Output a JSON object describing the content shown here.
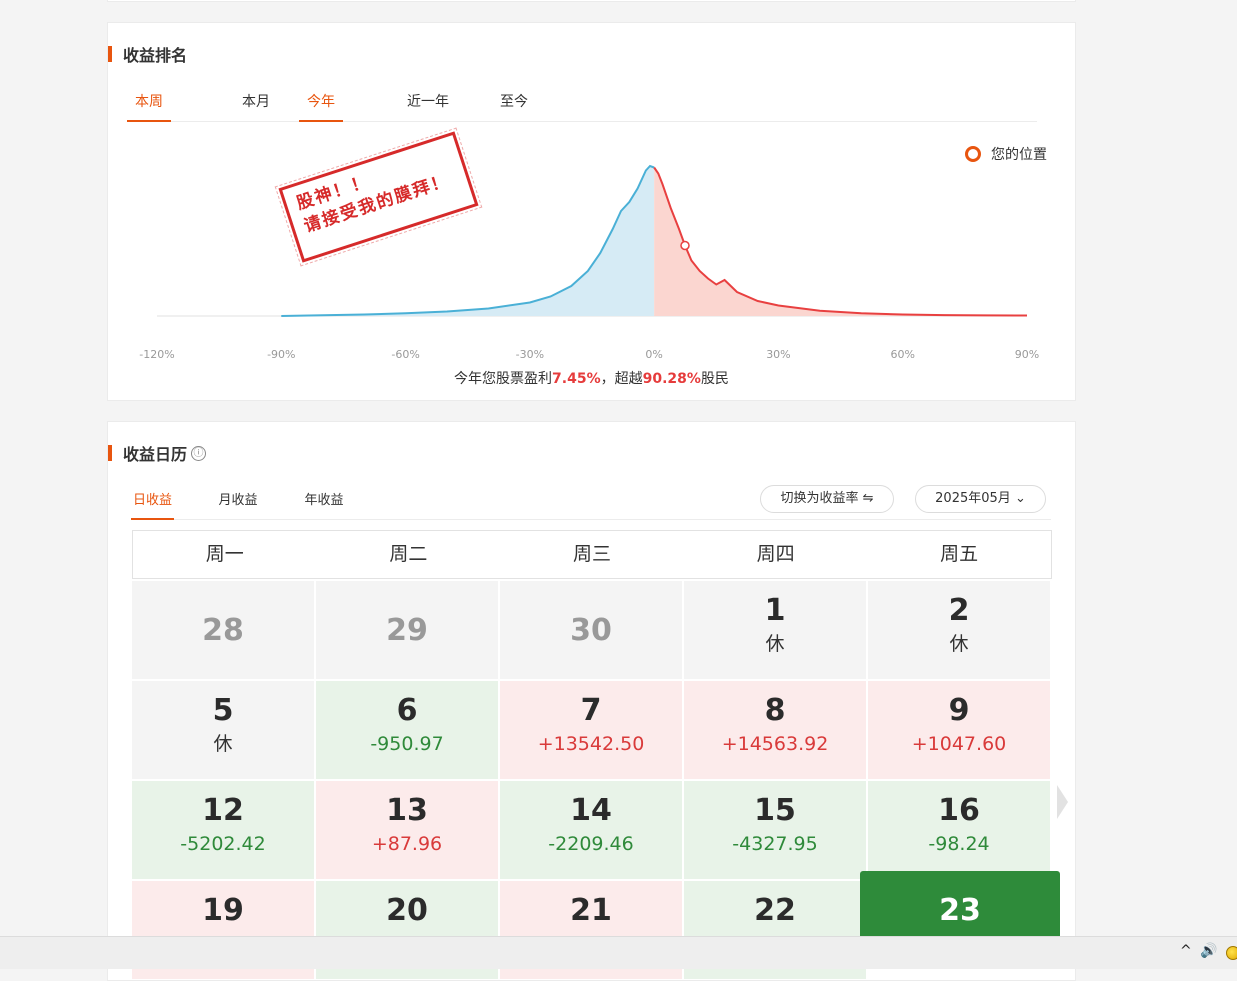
{
  "ranking": {
    "title": "收益排名",
    "tabs": [
      {
        "label": "本周",
        "active": true
      },
      {
        "label": "本月",
        "active": false
      },
      {
        "label": "今年",
        "active": true
      },
      {
        "label": "近一年",
        "active": false
      },
      {
        "label": "至今",
        "active": false
      }
    ],
    "legend_label": "您的位置",
    "stamp_line1": "股神！！",
    "stamp_line2": "请接受我的膜拜！",
    "summary": {
      "prefix": "今年您股票盈利",
      "profit": "7.45%",
      "middle": "，超越",
      "percentile": "90.28%",
      "suffix": "股民"
    }
  },
  "chart_data": {
    "type": "area",
    "xlabel": "",
    "ylabel": "",
    "x_ticks": [
      "-120%",
      "-90%",
      "-60%",
      "-30%",
      "0%",
      "30%",
      "60%",
      "90%"
    ],
    "xlim": [
      -120,
      90
    ],
    "ylim": [
      0,
      1
    ],
    "colors": {
      "loss_line": "#4ab0d6",
      "loss_fill": "#d6ebf5",
      "gain_line": "#e84040",
      "gain_fill": "#fbd6d0",
      "marker": "#e84040"
    },
    "series": [
      {
        "x": [
          -90,
          -80,
          -70,
          -60,
          -50,
          -40,
          -30,
          -25,
          -20,
          -16,
          -13,
          -10,
          -8,
          -6,
          -4,
          -2,
          -1,
          0
        ],
        "y": [
          0.0,
          0.005,
          0.01,
          0.018,
          0.03,
          0.05,
          0.09,
          0.13,
          0.2,
          0.3,
          0.42,
          0.58,
          0.7,
          0.76,
          0.85,
          0.97,
          1.0,
          0.99
        ]
      },
      {
        "x": [
          0,
          1,
          2,
          4,
          6,
          7.45,
          9,
          11,
          13,
          15,
          17,
          20,
          25,
          30,
          40,
          50,
          60,
          70,
          80,
          90
        ],
        "y": [
          0.99,
          0.95,
          0.88,
          0.72,
          0.58,
          0.47,
          0.37,
          0.3,
          0.25,
          0.21,
          0.24,
          0.16,
          0.1,
          0.07,
          0.035,
          0.018,
          0.01,
          0.006,
          0.004,
          0.003
        ]
      }
    ],
    "marker": {
      "x": 7.45,
      "y": 0.47
    }
  },
  "calendar": {
    "title": "收益日历",
    "info_icon": "ⓘ",
    "tabs": [
      {
        "label": "日收益",
        "active": true
      },
      {
        "label": "月收益",
        "active": false
      },
      {
        "label": "年收益",
        "active": false
      }
    ],
    "switch_label": "切换为收益率",
    "switch_icon": "⇋",
    "month_label": "2025年05月",
    "month_chevron": "⌄",
    "weekdays": [
      "周一",
      "周二",
      "周三",
      "周四",
      "周五"
    ],
    "days": [
      {
        "day": "28",
        "value": "",
        "kind": "gray other"
      },
      {
        "day": "29",
        "value": "",
        "kind": "gray other"
      },
      {
        "day": "30",
        "value": "",
        "kind": "gray other"
      },
      {
        "day": "1",
        "value": "休",
        "kind": "gray"
      },
      {
        "day": "2",
        "value": "休",
        "kind": "gray"
      },
      {
        "day": "5",
        "value": "休",
        "kind": "gray"
      },
      {
        "day": "6",
        "value": "-950.97",
        "kind": "down"
      },
      {
        "day": "7",
        "value": "+13542.50",
        "kind": "up"
      },
      {
        "day": "8",
        "value": "+14563.92",
        "kind": "up"
      },
      {
        "day": "9",
        "value": "+1047.60",
        "kind": "up"
      },
      {
        "day": "12",
        "value": "-5202.42",
        "kind": "down"
      },
      {
        "day": "13",
        "value": "+87.96",
        "kind": "up"
      },
      {
        "day": "14",
        "value": "-2209.46",
        "kind": "down"
      },
      {
        "day": "15",
        "value": "-4327.95",
        "kind": "down"
      },
      {
        "day": "16",
        "value": "-98.24",
        "kind": "down"
      },
      {
        "day": "19",
        "value": "",
        "kind": "up"
      },
      {
        "day": "20",
        "value": "",
        "kind": "down"
      },
      {
        "day": "21",
        "value": "",
        "kind": "up"
      },
      {
        "day": "22",
        "value": "",
        "kind": "down"
      },
      {
        "day": "23",
        "value": "",
        "kind": "today"
      }
    ]
  },
  "taskbar": {
    "up_icon": "^",
    "volume_icon": "🔊"
  }
}
